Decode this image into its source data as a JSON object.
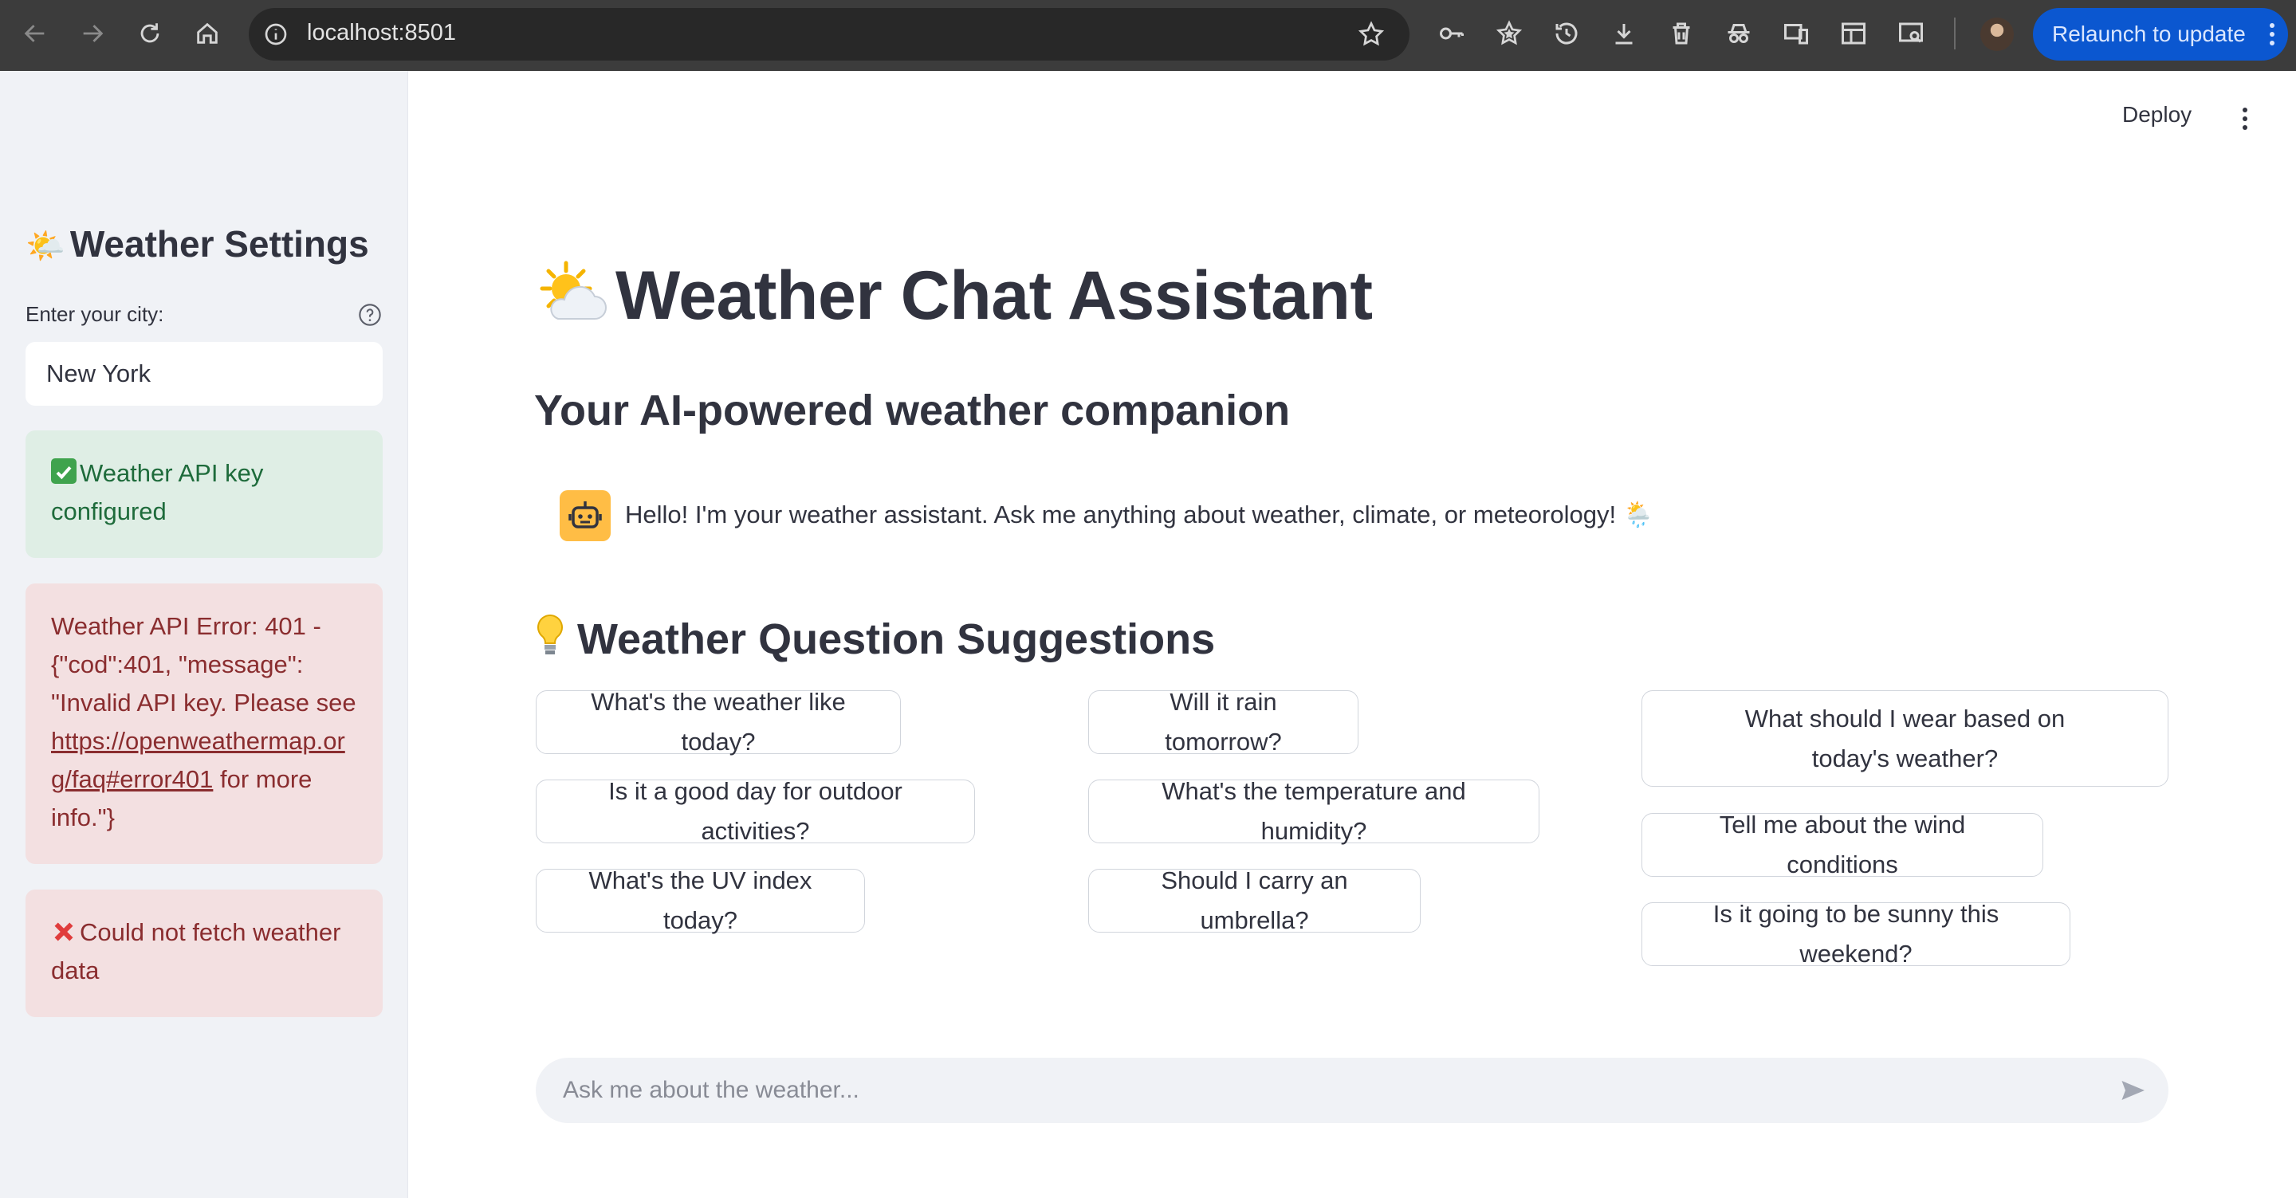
{
  "browser": {
    "url": "localhost:8501",
    "relaunch_label": "Relaunch to update"
  },
  "sidebar": {
    "title": "Weather Settings",
    "title_emoji": "🌤️",
    "city_label": "Enter your city:",
    "city_value": "New York",
    "success_text": "Weather API key configured",
    "api_error_prefix": "Weather API Error: 401 - {\"cod\":401, \"message\": \"Invalid API key. Please see ",
    "api_error_link": "https://openweathermap.org/faq#error401",
    "api_error_suffix": " for more info.\"}",
    "fetch_error_text": "Could not fetch weather data"
  },
  "header": {
    "deploy_label": "Deploy"
  },
  "main": {
    "title": "Weather Chat Assistant",
    "subtitle": "Your AI-powered weather companion",
    "assistant_message": "Hello! I'm your weather assistant. Ask me anything about weather, climate, or meteorology! 🌦️",
    "suggestions_title": "Weather Question Suggestions",
    "suggestions": [
      "What's the weather like today?",
      "Will it rain tomorrow?",
      "What should I wear based on today's weather?",
      "Is it a good day for outdoor activities?",
      "What's the temperature and humidity?",
      "Tell me about the wind conditions",
      "What's the UV index today?",
      "Should I carry an umbrella?",
      "Is it going to be sunny this weekend?"
    ],
    "chat_placeholder": "Ask me about the weather..."
  },
  "colors": {
    "accent": "#ff4b4b",
    "sidebar_bg": "#f0f2f6",
    "success_bg": "#dfeee5",
    "error_bg": "#f3e0e1",
    "relaunch_bg": "#0b57d0",
    "bot_avatar": "#ffbd45"
  }
}
